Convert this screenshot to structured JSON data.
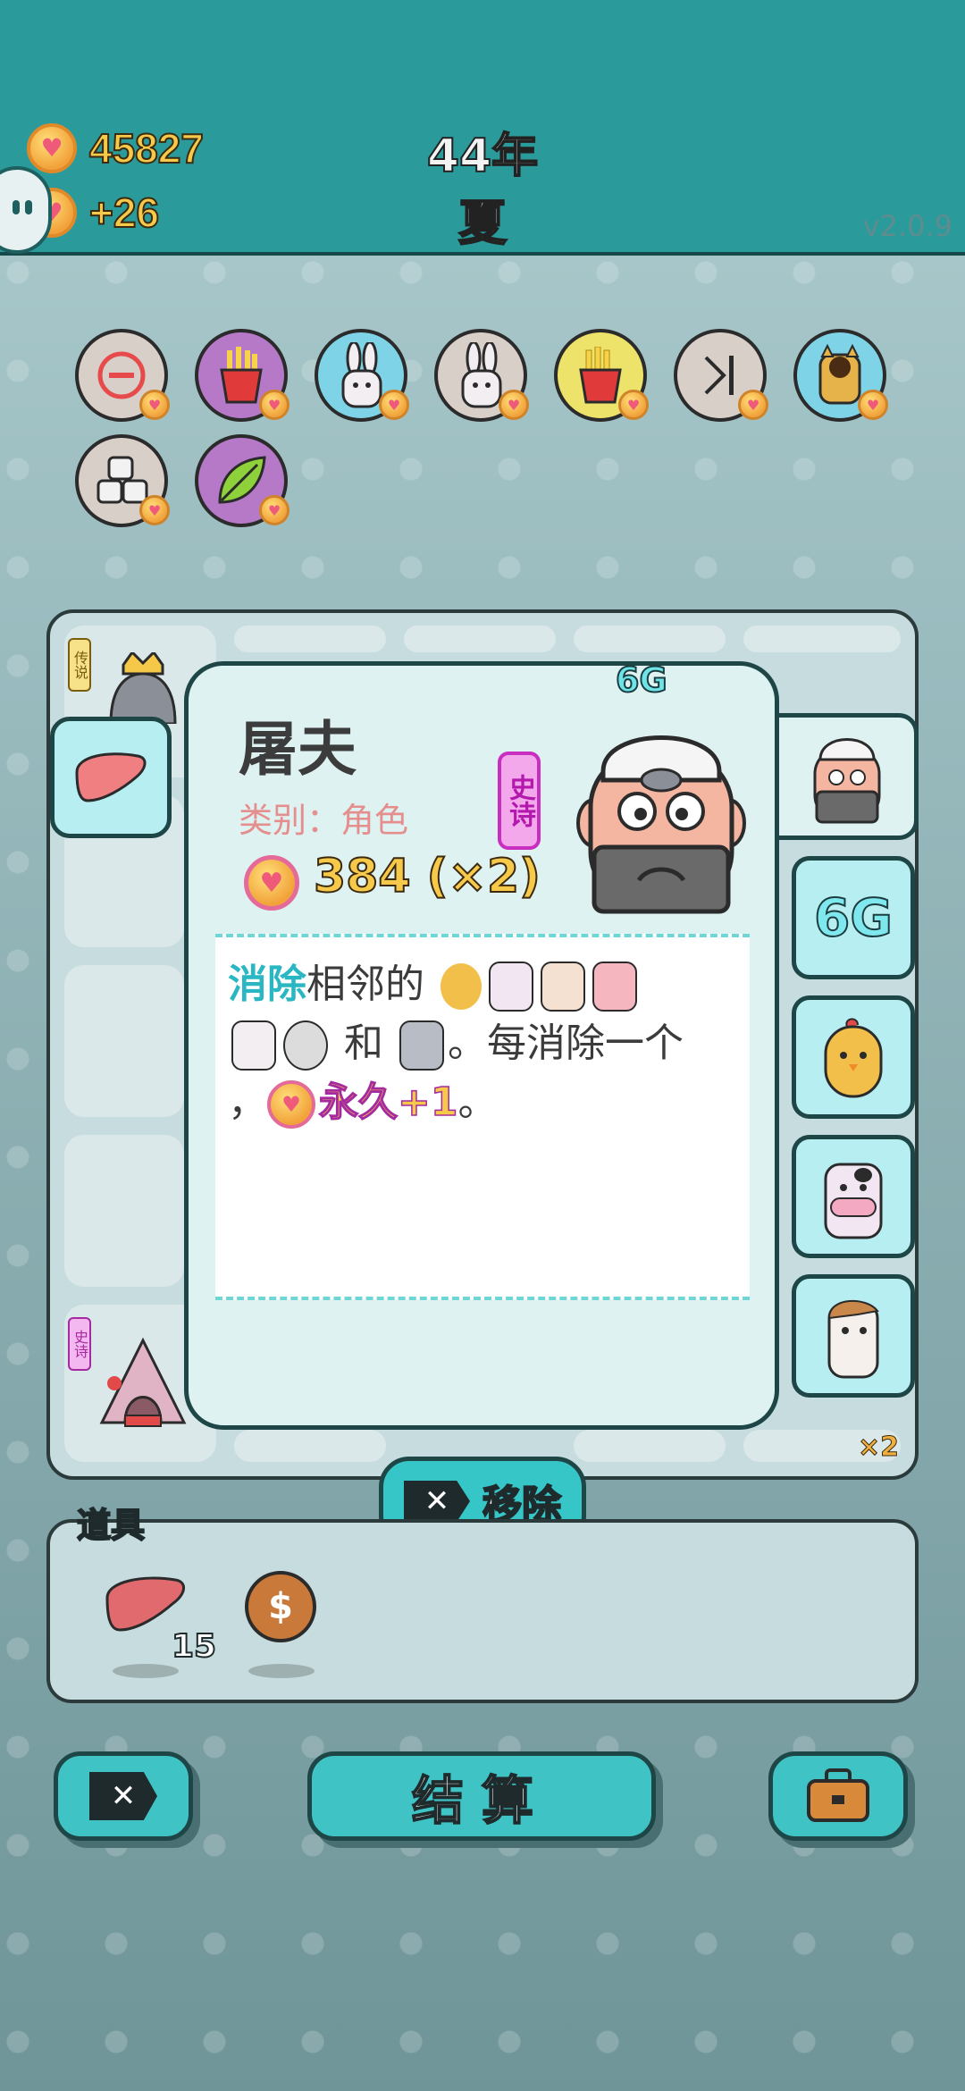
{
  "header": {
    "coins": "45827",
    "income": "+26",
    "year": "44年",
    "season": "夏",
    "version": "v2.0.9"
  },
  "items": [
    {
      "name": "minus",
      "icon": "minus-circle-icon",
      "bg": "#d8cfc9"
    },
    {
      "name": "fries",
      "icon": "fries-icon",
      "bg": "#b679c8"
    },
    {
      "name": "rabbit",
      "icon": "rabbit-icon",
      "bg": "#7fd3e6"
    },
    {
      "name": "rabbit2",
      "icon": "rabbit-icon",
      "bg": "#d8cfc9"
    },
    {
      "name": "fries2",
      "icon": "fries-icon",
      "bg": "#ede26a"
    },
    {
      "name": "skip",
      "icon": "skip-icon",
      "bg": "#d8cfc9"
    },
    {
      "name": "cat",
      "icon": "cat-icon",
      "bg": "#7fd3e6"
    },
    {
      "name": "boxes",
      "icon": "boxes-icon",
      "bg": "#d8cfc9"
    },
    {
      "name": "leaf",
      "icon": "leaf-icon",
      "bg": "#b679c8"
    }
  ],
  "board": {
    "legend_tag": "传说",
    "epic_tag": "史诗",
    "multiplier": "×2"
  },
  "popup": {
    "title": "屠夫",
    "category": "类别：角色",
    "rarity": "史诗",
    "price": "384 (×2)",
    "generation": "6G",
    "desc_keyword": "消除",
    "desc_part1": "相邻的",
    "desc_part2": "和",
    "desc_part3": "。每消除一个",
    "desc_part4": "，",
    "desc_reward": "永久+1",
    "desc_end": "。"
  },
  "tabs": {
    "gen_label": "6G"
  },
  "actions": {
    "remove_label": "移除",
    "settle_label": "结算"
  },
  "props": {
    "label": "道具",
    "liver_count": "15"
  },
  "colors": {
    "header": "#2a9b9a",
    "accent": "#37c6c8",
    "coin_text": "#f6c94a",
    "epic": "#c62fc0"
  }
}
